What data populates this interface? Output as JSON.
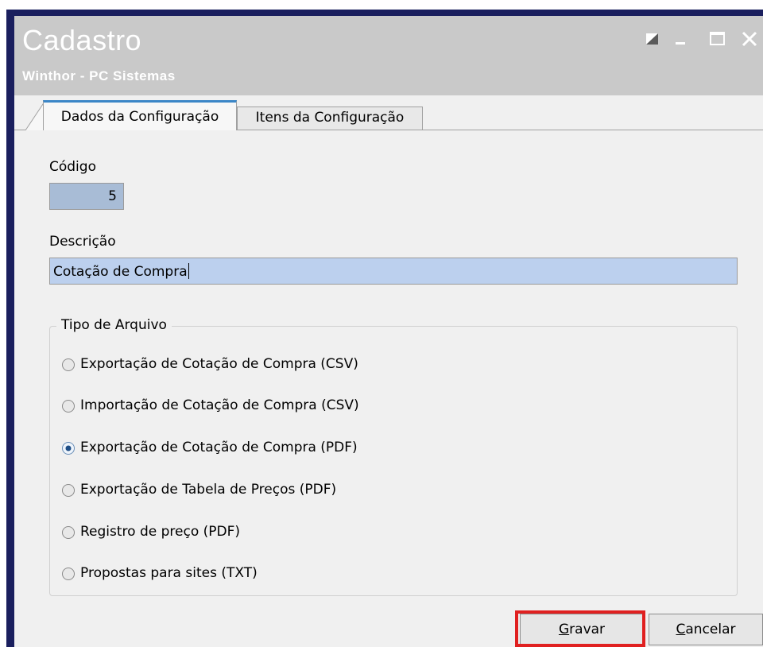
{
  "window": {
    "title": "Cadastro",
    "subtitle": "Winthor - PC Sistemas",
    "controls": [
      "restore-icon",
      "minimize-icon",
      "maximize-icon",
      "close-icon"
    ]
  },
  "tabs": [
    {
      "label": "Dados da Configuração",
      "active": true
    },
    {
      "label": "Itens da Configuração",
      "active": false
    }
  ],
  "form": {
    "codigo_label": "Código",
    "codigo_value": "5",
    "descricao_label": "Descrição",
    "descricao_value": "Cotação de Compra"
  },
  "tipo_arquivo": {
    "legend": "Tipo de Arquivo",
    "options": [
      {
        "label": "Exportação de Cotação de Compra (CSV)",
        "selected": false
      },
      {
        "label": "Importação de Cotação de Compra (CSV)",
        "selected": false
      },
      {
        "label": "Exportação de Cotação de Compra (PDF)",
        "selected": true
      },
      {
        "label": "Exportação de Tabela de Preços (PDF)",
        "selected": false
      },
      {
        "label": "Registro de preço (PDF)",
        "selected": false
      },
      {
        "label": "Propostas para sites (TXT)",
        "selected": false
      }
    ]
  },
  "buttons": {
    "gravar_accel": "G",
    "gravar_rest": "ravar",
    "cancelar_accel": "C",
    "cancelar_rest": "ancelar"
  },
  "colors": {
    "frame": "#1a1f5e",
    "titlebar": "#c9c9c9",
    "tab_accent": "#3b86c7",
    "field_selected": "#bcd0ee",
    "highlight": "#e02020"
  }
}
